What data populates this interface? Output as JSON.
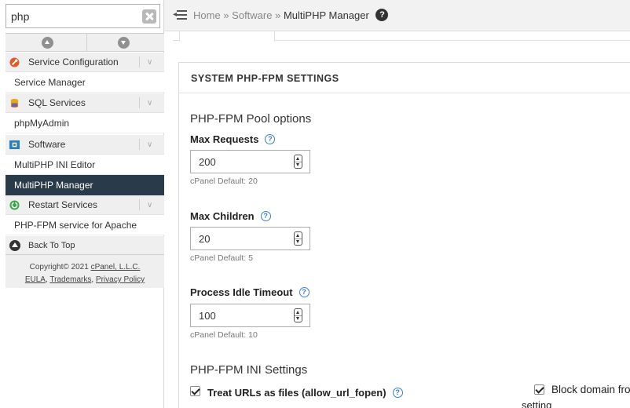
{
  "search": {
    "value": "php"
  },
  "sidebar": {
    "categories": [
      {
        "label": "Service Configuration",
        "icon": "wrench-icon",
        "chevron": "∨"
      },
      {
        "label": "SQL Services",
        "icon": "database-icon",
        "chevron": "∨"
      },
      {
        "label": "Software",
        "icon": "software-icon",
        "chevron": "∨"
      },
      {
        "label": "Restart Services",
        "icon": "restart-icon",
        "chevron": "∨"
      }
    ],
    "items": [
      {
        "label": "Service Manager"
      },
      {
        "label": "phpMyAdmin"
      },
      {
        "label": "MultiPHP INI Editor"
      },
      {
        "label": "MultiPHP Manager",
        "active": true
      },
      {
        "label": "PHP-FPM service for Apache"
      }
    ],
    "back_to_top": "Back To Top",
    "footer": {
      "copyright_prefix": "Copyright© 2021",
      "copyright_link": "cPanel, L.L.C.",
      "links": [
        "EULA",
        "Trademarks",
        "Privacy Policy"
      ]
    }
  },
  "breadcrumb": {
    "home": "Home",
    "sep": "»",
    "parent": "Software",
    "current": "MultiPHP Manager",
    "help": "?"
  },
  "panel": {
    "header": "SYSTEM PHP-FPM SETTINGS",
    "pool_title": "PHP-FPM Pool options",
    "fields": [
      {
        "label": "Max Requests",
        "value": "200",
        "hint": "cPanel Default: 20"
      },
      {
        "label": "Max Children",
        "value": "20",
        "hint": "cPanel Default: 5"
      },
      {
        "label": "Process Idle Timeout",
        "value": "100",
        "hint": "cPanel Default: 10"
      }
    ],
    "ini_title": "PHP-FPM INI Settings",
    "checkboxes": [
      {
        "label": "Treat URLs as files (allow_url_fopen)",
        "checked": true
      },
      {
        "label": "Block domain fro",
        "continuation": "setting",
        "checked": true
      }
    ],
    "help_glyph": "?"
  },
  "colors": {
    "active_nav_bg": "#293a4a",
    "help_blue": "#3b7dd8",
    "sidebar_bg": "#efefef"
  }
}
